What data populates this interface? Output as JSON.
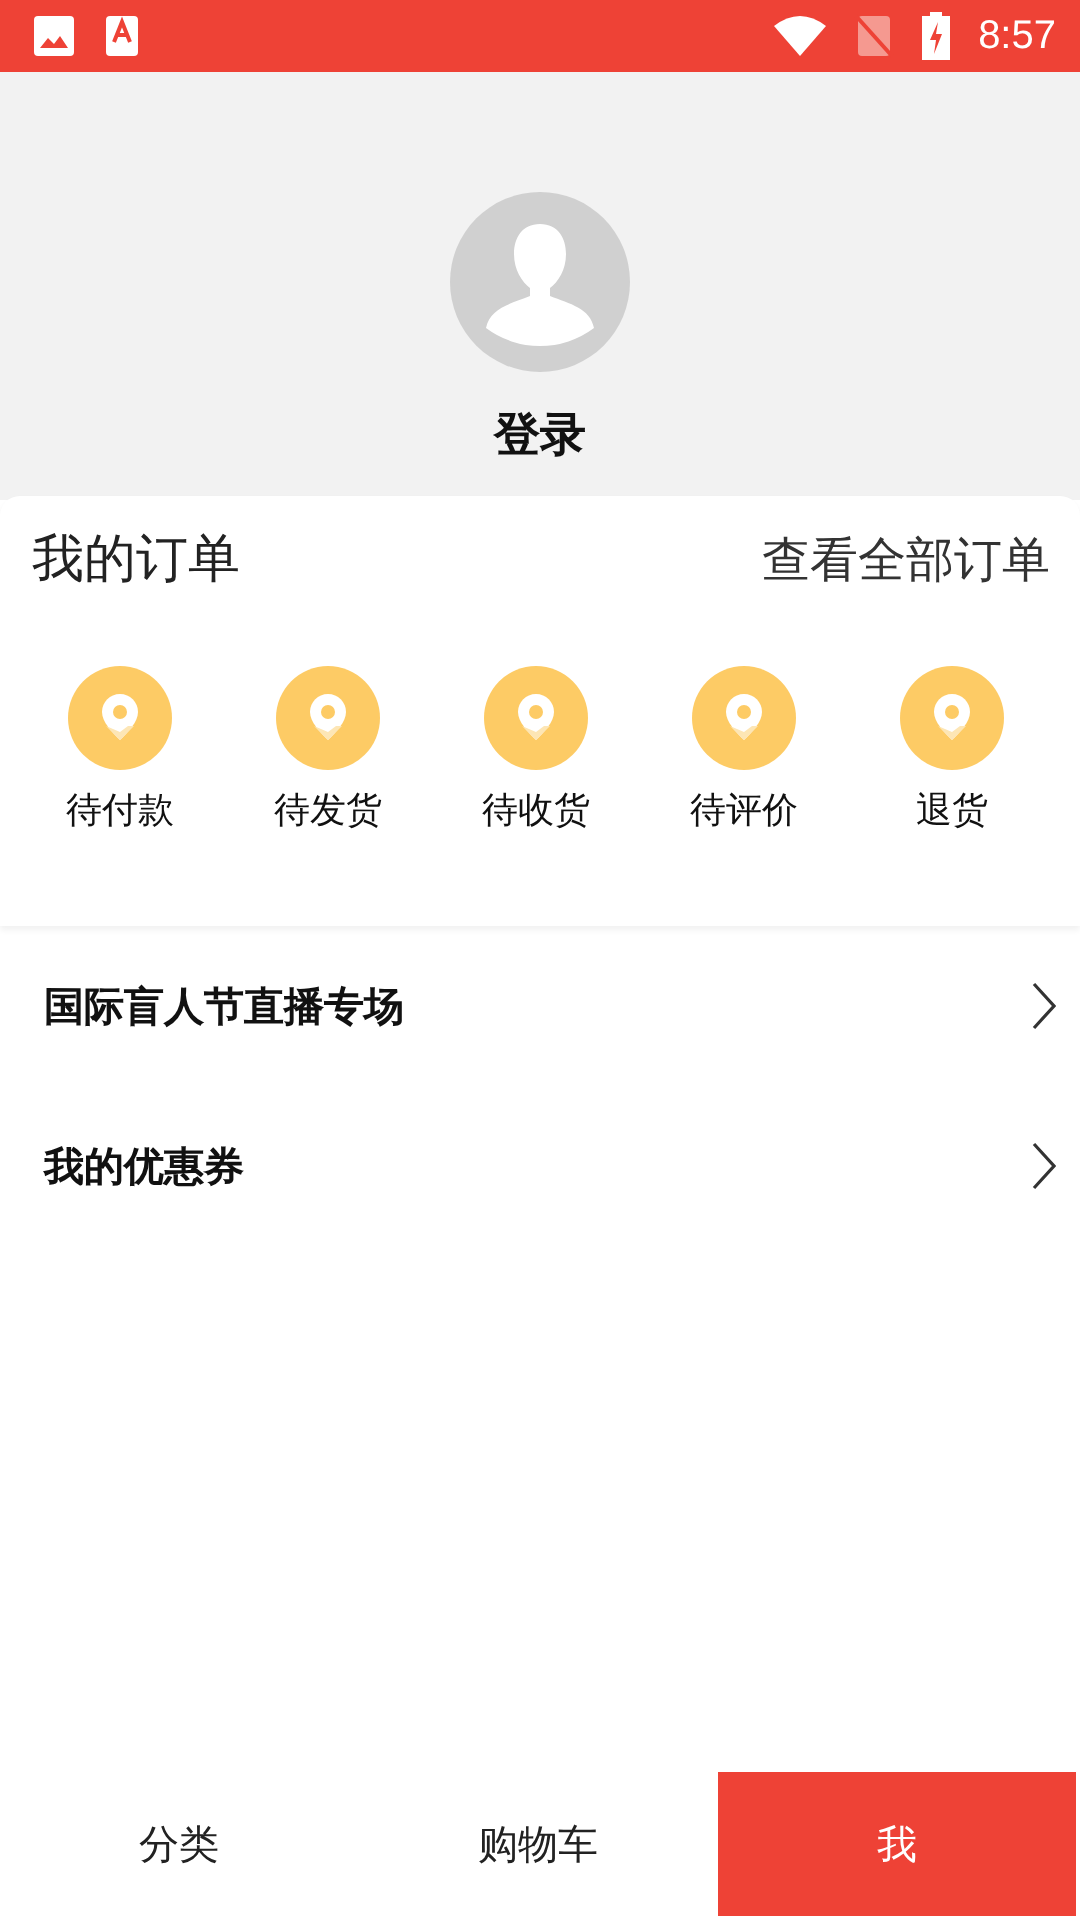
{
  "status_bar": {
    "time": "8:57"
  },
  "profile": {
    "login": "登录"
  },
  "orders": {
    "title": "我的订单",
    "view_all": "查看全部订单",
    "items": [
      {
        "label": "待付款"
      },
      {
        "label": "待发货"
      },
      {
        "label": "待收货"
      },
      {
        "label": "待评价"
      },
      {
        "label": "退货"
      }
    ]
  },
  "menu": [
    {
      "label": "国际盲人节直播专场"
    },
    {
      "label": "我的优惠券"
    }
  ],
  "tabs": [
    {
      "label": "分类",
      "selected": false
    },
    {
      "label": "购物车",
      "selected": false
    },
    {
      "label": "我",
      "selected": true
    }
  ]
}
